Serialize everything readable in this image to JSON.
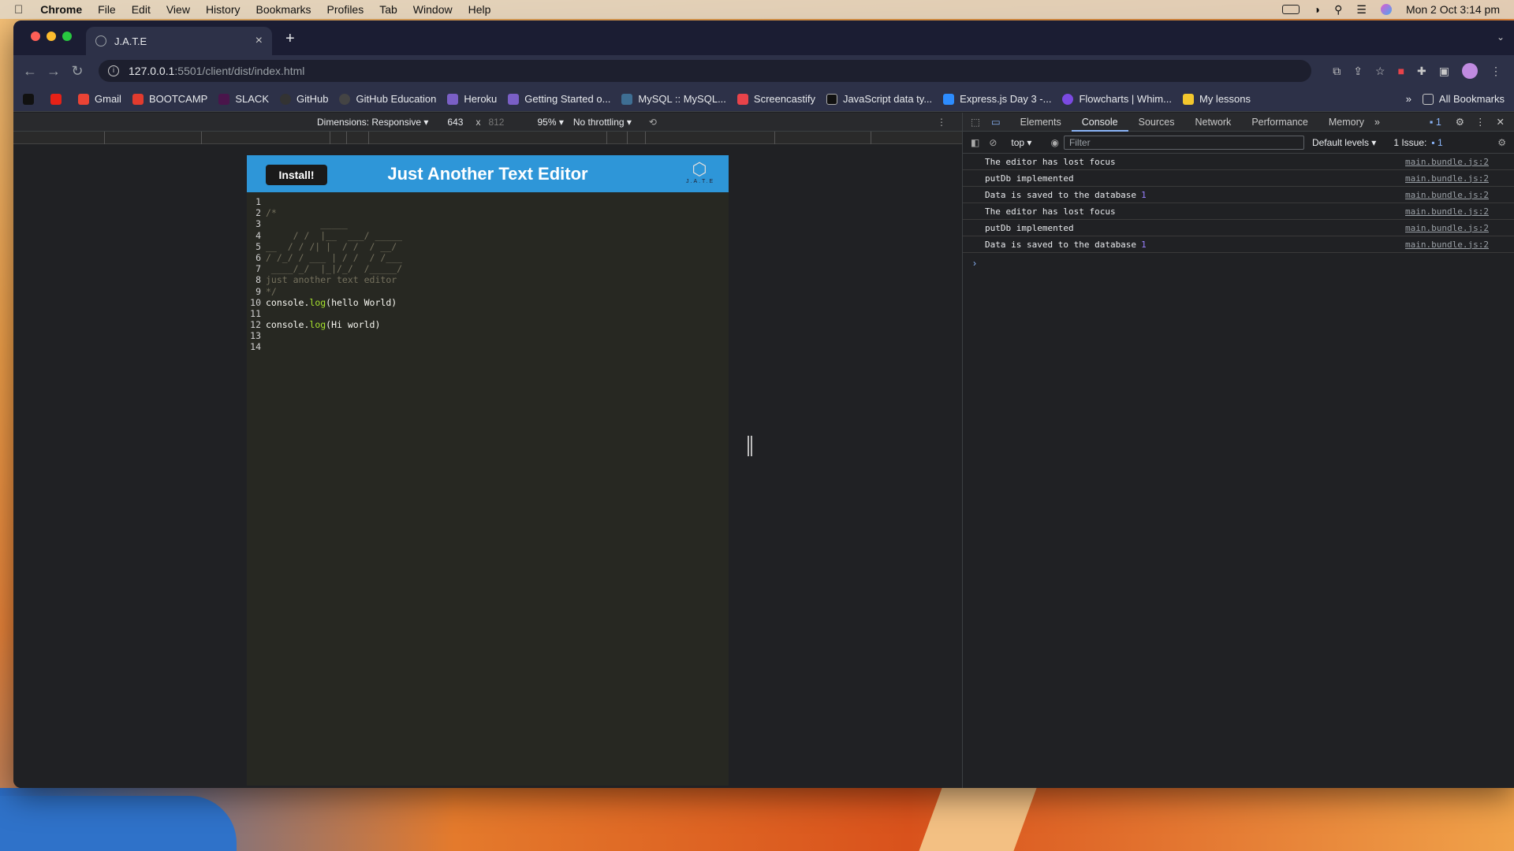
{
  "menubar": {
    "app": "Chrome",
    "items": [
      "File",
      "Edit",
      "View",
      "History",
      "Bookmarks",
      "Profiles",
      "Tab",
      "Window",
      "Help"
    ],
    "clock": "Mon 2 Oct  3:14 pm"
  },
  "tab": {
    "title": "J.A.T.E"
  },
  "address": {
    "host": "127.0.0.1",
    "rest": ":5501/client/dist/index.html"
  },
  "bookmarks": {
    "items": [
      "Gmail",
      "BOOTCAMP",
      "SLACK",
      "GitHub",
      "GitHub Education",
      "Heroku",
      "Getting Started o...",
      "MySQL :: MySQL...",
      "Screencastify",
      "JavaScript data ty...",
      "Express.js Day 3 -...",
      "Flowcharts | Whim...",
      "My lessons"
    ],
    "more": "»",
    "all": "All Bookmarks"
  },
  "devbar": {
    "dimensions": "Dimensions: Responsive ▾",
    "width": "643",
    "times": "x",
    "height": "812",
    "zoom": "95% ▾",
    "throttle": "No throttling ▾"
  },
  "app": {
    "install": "Install!",
    "title": "Just Another Text Editor",
    "logo_text": "J.A.T.E"
  },
  "editor_lines": [
    {
      "n": "1",
      "c": "",
      "t": ""
    },
    {
      "n": "2",
      "c": "/*",
      "t": "cm"
    },
    {
      "n": "3",
      "c": "          _____",
      "t": "cm"
    },
    {
      "n": "4",
      "c": "     / /  |__  ___/ _____",
      "t": "cm"
    },
    {
      "n": "5",
      "c": "__  / / /| |  / /  / __/",
      "t": "cm"
    },
    {
      "n": "6",
      "c": "/ /_/ / ___ | / /  / /___",
      "t": "cm"
    },
    {
      "n": "7",
      "c": " ____/_/  |_|/_/  /_____/",
      "t": "cm"
    },
    {
      "n": "8",
      "c": "just another text editor",
      "t": "cm"
    },
    {
      "n": "9",
      "c": "*/",
      "t": "cm"
    },
    {
      "n": "10",
      "c": "console.",
      "c2": "log",
      "c3": "(hello World)",
      "t": "code"
    },
    {
      "n": "11",
      "c": "",
      "t": ""
    },
    {
      "n": "12",
      "c": "console.",
      "c2": "log",
      "c3": "(Hi world)",
      "t": "code"
    },
    {
      "n": "13",
      "c": "",
      "t": ""
    },
    {
      "n": "14",
      "c": "",
      "t": ""
    }
  ],
  "devtools": {
    "tabs": [
      "Elements",
      "Console",
      "Sources",
      "Network",
      "Performance",
      "Memory"
    ],
    "issues_badge": "1",
    "context": "top",
    "filter_placeholder": "Filter",
    "levels": "Default levels ▾",
    "issue_summary": "1 Issue:",
    "issue_count": "1",
    "logs": [
      {
        "msg": "The editor has lost focus",
        "num": "",
        "src": "main.bundle.js:2"
      },
      {
        "msg": "putDb  implemented",
        "num": "",
        "src": "main.bundle.js:2"
      },
      {
        "msg": "Data is saved to the database",
        "num": "1",
        "src": "main.bundle.js:2"
      },
      {
        "msg": "The editor has lost focus",
        "num": "",
        "src": "main.bundle.js:2"
      },
      {
        "msg": "putDb  implemented",
        "num": "",
        "src": "main.bundle.js:2"
      },
      {
        "msg": "Data is saved to the database",
        "num": "1",
        "src": "main.bundle.js:2"
      }
    ],
    "prompt": "›"
  }
}
